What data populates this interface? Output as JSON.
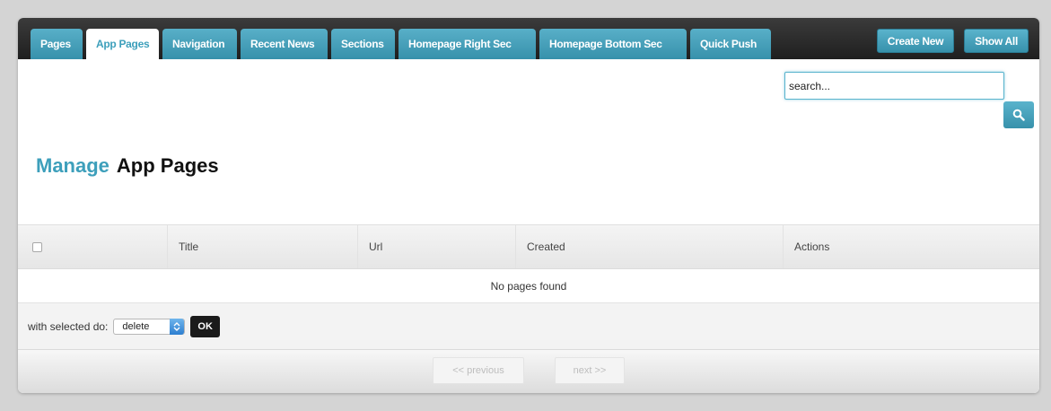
{
  "tabs": [
    {
      "label": "Pages"
    },
    {
      "label": "App Pages"
    },
    {
      "label": "Navigation"
    },
    {
      "label": "Recent News"
    },
    {
      "label": "Sections"
    },
    {
      "label": "Homepage Right Sec"
    },
    {
      "label": "Homepage Bottom Sec"
    },
    {
      "label": "Quick Push"
    }
  ],
  "active_tab": "App Pages",
  "actions": {
    "create_new": "Create New",
    "show_all": "Show All"
  },
  "search": {
    "value": "search...",
    "button_icon": "search-icon"
  },
  "heading": {
    "manage": "Manage",
    "section": "App Pages"
  },
  "table": {
    "columns": [
      "Title",
      "Url",
      "Created",
      "Actions"
    ],
    "empty_message": "No pages found"
  },
  "bulk": {
    "label": "with selected do:",
    "selected": "delete",
    "ok": "OK"
  },
  "pagination": {
    "previous": "<< previous",
    "next": "next >>"
  },
  "colors": {
    "accent": "#3d9fbb",
    "topbar": "#2b2b2b",
    "background": "#d4d4d4"
  }
}
